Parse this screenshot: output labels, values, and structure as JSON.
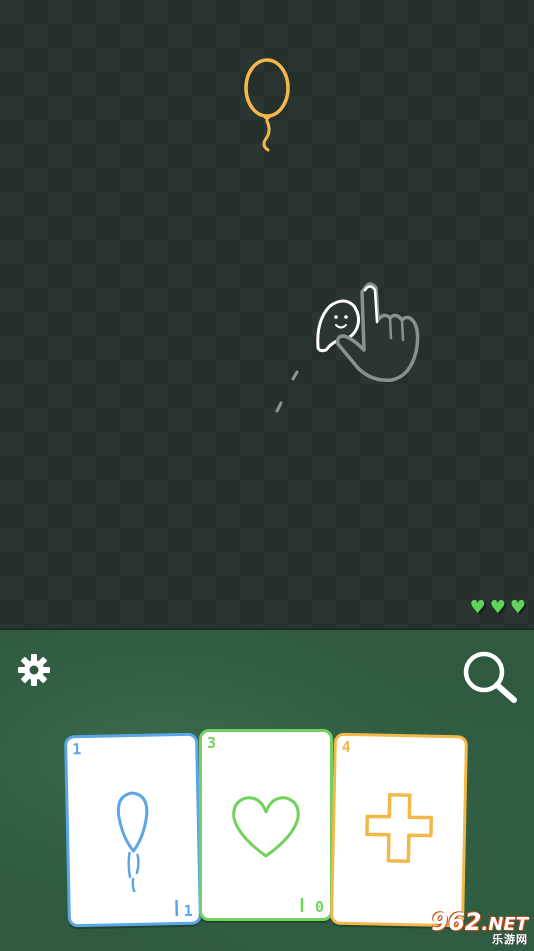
{
  "colors": {
    "board_dark": "#25302c",
    "board_light": "#2b3632",
    "panel": "#2f5a40",
    "balloon": "#f2b84a",
    "blue_card": "#5aa6e6",
    "green_card": "#72d25e",
    "orange_card": "#f2b84a",
    "life_heart": "#5fd35a"
  },
  "board": {
    "target": "balloon-icon",
    "player": "ghost-icon",
    "hint": "pointing-hand-icon",
    "lives": [
      {
        "icon": "life-heart-icon",
        "glyph": "♥"
      },
      {
        "icon": "life-heart-icon",
        "glyph": "♥"
      },
      {
        "icon": "life-heart-icon",
        "glyph": "♥"
      }
    ]
  },
  "controls": {
    "settings_icon": "gear-icon",
    "search_icon": "magnifier-icon"
  },
  "cards": [
    {
      "icon": "balloon-card-icon",
      "cost": "1",
      "corner": "1",
      "color": "#5aa6e6"
    },
    {
      "icon": "heart-card-icon",
      "cost": "3",
      "corner": "0",
      "color": "#72d25e"
    },
    {
      "icon": "plus-card-icon",
      "cost": "4",
      "corner": "",
      "color": "#f2b84a"
    }
  ],
  "watermark": {
    "main": "962",
    "ext": ".NET",
    "sub": "乐游网"
  }
}
